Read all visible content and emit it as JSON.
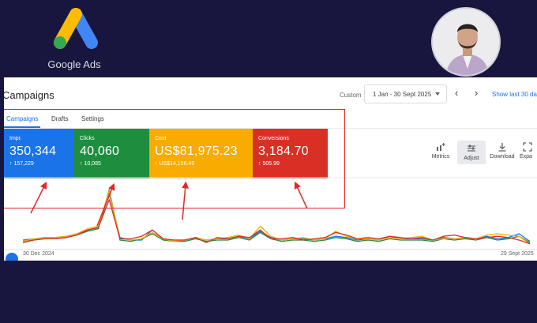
{
  "brand": {
    "logo_text": "Google Ads"
  },
  "header": {
    "title": "Campaigns",
    "custom_label": "Custom",
    "date_range": "1 Jan - 30 Sept 2025",
    "show_last": "Show last 30 da"
  },
  "tabs": [
    {
      "label": "Campaigns",
      "active": true
    },
    {
      "label": "Drafts",
      "active": false
    },
    {
      "label": "Settings",
      "active": false
    }
  ],
  "metrics": [
    {
      "label": "Impr.",
      "value": "350,344",
      "delta": "157,229",
      "color": "#1a73e8"
    },
    {
      "label": "Clicks",
      "value": "40,060",
      "delta": "10,085",
      "color": "#1e8e3e"
    },
    {
      "label": "Cost",
      "value": "US$81,975.23",
      "delta": "US$14,156.49",
      "color": "#f9ab00"
    },
    {
      "label": "Conversions",
      "value": "3,184.70",
      "delta": "505.99",
      "color": "#d93025"
    }
  ],
  "toolbar": {
    "metrics_label": "Metrics",
    "adjust_label": "Adjust",
    "download_label": "Download",
    "expand_label": "Expa"
  },
  "chart_data": {
    "type": "line",
    "x_start_label": "30 Dec 2024",
    "x_end_label": "29 Sept 2025",
    "series": [
      {
        "color": "#1a73e8",
        "values": [
          5,
          6,
          7,
          7,
          8,
          10,
          13,
          15,
          42,
          7,
          5,
          5,
          13,
          6,
          5,
          5,
          7,
          5,
          6,
          6,
          8,
          6,
          12,
          7,
          5,
          6,
          6,
          5,
          6,
          8,
          7,
          5,
          6,
          5,
          8,
          6,
          6,
          6,
          5,
          7,
          6,
          7,
          6,
          8,
          6,
          7,
          10,
          4
        ]
      },
      {
        "color": "#1e8e3e",
        "values": [
          4,
          5,
          6,
          6,
          7,
          9,
          12,
          14,
          45,
          5,
          4,
          6,
          10,
          5,
          4,
          4,
          6,
          4,
          5,
          5,
          7,
          5,
          11,
          6,
          4,
          5,
          5,
          4,
          5,
          7,
          6,
          4,
          5,
          4,
          6,
          5,
          5,
          5,
          4,
          6,
          5,
          6,
          5,
          7,
          5,
          6,
          8,
          3
        ]
      },
      {
        "color": "#f9ab00",
        "values": [
          4,
          6,
          7,
          7,
          8,
          10,
          14,
          16,
          44,
          6,
          5,
          6,
          11,
          6,
          4,
          5,
          7,
          5,
          6,
          7,
          9,
          6,
          16,
          8,
          5,
          6,
          7,
          5,
          6,
          12,
          8,
          6,
          6,
          5,
          7,
          6,
          7,
          8,
          5,
          6,
          6,
          7,
          6,
          9,
          10,
          9,
          8,
          2
        ]
      },
      {
        "color": "#d93025",
        "values": [
          3,
          5,
          6,
          6,
          7,
          9,
          13,
          15,
          37,
          6,
          6,
          8,
          13,
          6,
          5,
          5,
          7,
          3,
          7,
          6,
          8,
          7,
          13,
          6,
          6,
          7,
          5,
          6,
          7,
          11,
          9,
          6,
          7,
          6,
          8,
          7,
          6,
          7,
          5,
          8,
          9,
          7,
          6,
          7,
          8,
          7,
          5,
          2
        ]
      }
    ]
  }
}
